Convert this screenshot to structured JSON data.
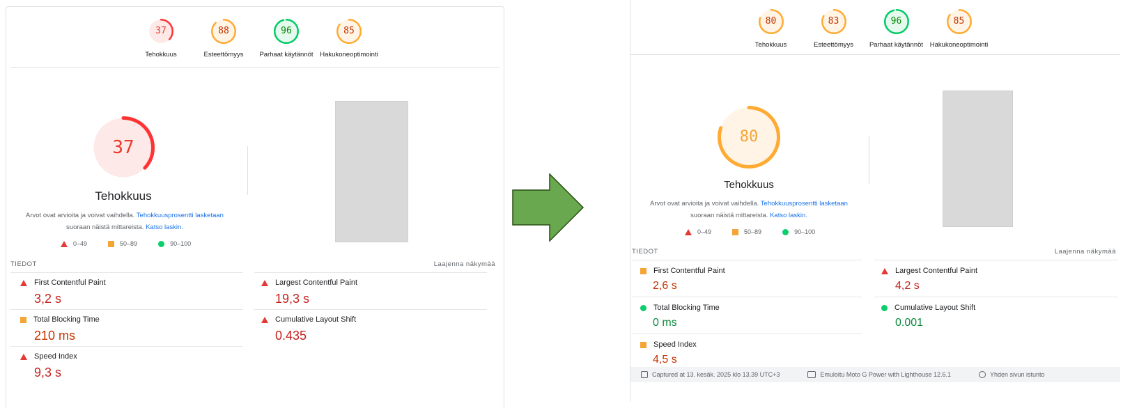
{
  "colors": {
    "red": "#f33",
    "orange": "#fa3",
    "green": "#0c6",
    "link": "#1a73e8"
  },
  "left": {
    "gauges": [
      {
        "score": "37",
        "label": "Tehokkuus",
        "color": "red",
        "fraction": 0.37
      },
      {
        "score": "88",
        "label": "Esteettömyys",
        "color": "orange",
        "fraction": 0.88
      },
      {
        "score": "96",
        "label": "Parhaat käytännöt",
        "color": "green",
        "fraction": 0.96
      },
      {
        "score": "85",
        "label": "Hakukoneoptimointi",
        "color": "orange",
        "fraction": 0.85
      }
    ],
    "big": {
      "score": "37",
      "title": "Tehokkuus",
      "color": "red",
      "fraction": 0.37
    },
    "note": {
      "text1": "Arvot ovat arvioita ja voivat vaihdella.",
      "link1": "Tehokkuusprosentti lasketaan",
      "text2": "suoraan näistä mittareista.",
      "link2": "Katso laskin."
    },
    "legend": [
      "0–49",
      "50–89",
      "90–100"
    ],
    "metrics_title": "TIEDOT",
    "expand": "Laajenna näkymää",
    "metrics": [
      {
        "name": "First Contentful Paint",
        "value": "3,2 s",
        "status": "red"
      },
      {
        "name": "Largest Contentful Paint",
        "value": "19,3 s",
        "status": "red"
      },
      {
        "name": "Total Blocking Time",
        "value": "210 ms",
        "status": "orange"
      },
      {
        "name": "Cumulative Layout Shift",
        "value": "0.435",
        "status": "red"
      },
      {
        "name": "Speed Index",
        "value": "9,3 s",
        "status": "red"
      }
    ]
  },
  "right": {
    "gauges": [
      {
        "score": "80",
        "label": "Tehokkuus",
        "color": "orange",
        "fraction": 0.8
      },
      {
        "score": "83",
        "label": "Esteettömyys",
        "color": "orange",
        "fraction": 0.83
      },
      {
        "score": "96",
        "label": "Parhaat käytännöt",
        "color": "green",
        "fraction": 0.96
      },
      {
        "score": "85",
        "label": "Hakukoneoptimointi",
        "color": "orange",
        "fraction": 0.85
      }
    ],
    "big": {
      "score": "80",
      "title": "Tehokkuus",
      "color": "orange",
      "fraction": 0.8
    },
    "note": {
      "text1": "Arvot ovat arvioita ja voivat vaihdella.",
      "link1": "Tehokkuusprosentti lasketaan",
      "text2": "suoraan näistä mittareista.",
      "link2": "Katso laskin."
    },
    "legend": [
      "0–49",
      "50–89",
      "90–100"
    ],
    "metrics_title": "TIEDOT",
    "expand": "Laajenna näkymää",
    "metrics": [
      {
        "name": "First Contentful Paint",
        "value": "2,6 s",
        "status": "orange"
      },
      {
        "name": "Largest Contentful Paint",
        "value": "4,2 s",
        "status": "red"
      },
      {
        "name": "Total Blocking Time",
        "value": "0 ms",
        "status": "green"
      },
      {
        "name": "Cumulative Layout Shift",
        "value": "0.001",
        "status": "green"
      },
      {
        "name": "Speed Index",
        "value": "4,5 s",
        "status": "orange"
      }
    ],
    "footer": [
      "Captured at 13. kesäk. 2025 klo 13.39 UTC+3",
      "Emuloitu Moto G Power with Lighthouse 12.6.1",
      "Yhden sivun istunto"
    ]
  }
}
